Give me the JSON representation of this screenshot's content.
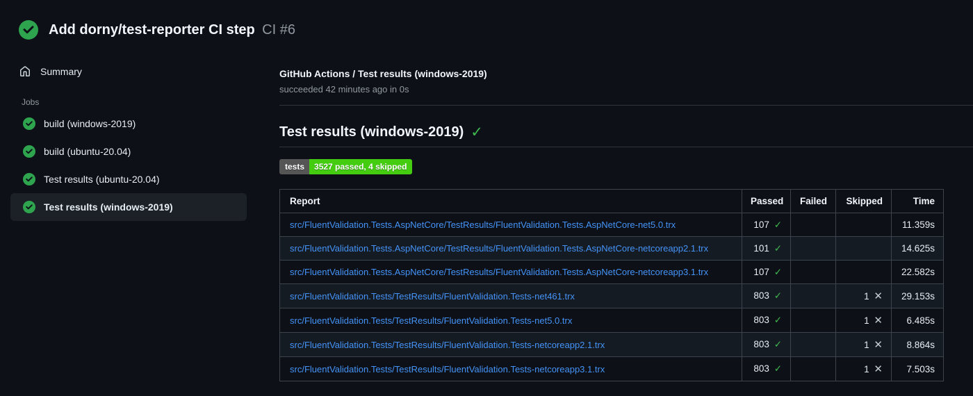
{
  "colors": {
    "background": "#0d1117",
    "success_green": "#2ea44f",
    "check_green": "#3fb950",
    "link_blue": "#4493f8",
    "badge_label_bg": "#555555",
    "badge_value_bg": "#44cc11",
    "selected_item_bg": "#1c2128"
  },
  "run_header": {
    "title": "Add dorny/test-reporter CI step",
    "run_number": "CI #6",
    "status": "success"
  },
  "sidebar": {
    "summary_label": "Summary",
    "jobs_label": "Jobs",
    "jobs": [
      {
        "label": "build (windows-2019)",
        "status": "success",
        "selected": false
      },
      {
        "label": "build (ubuntu-20.04)",
        "status": "success",
        "selected": false
      },
      {
        "label": "Test results (ubuntu-20.04)",
        "status": "success",
        "selected": false
      },
      {
        "label": "Test results (windows-2019)",
        "status": "success",
        "selected": true
      }
    ]
  },
  "main": {
    "job_title": "GitHub Actions / Test results (windows-2019)",
    "job_status_line": "succeeded 42 minutes ago in 0s",
    "section_title": "Test results (windows-2019)",
    "section_check": "✓",
    "badge": {
      "label": "tests",
      "value": "3527 passed, 4 skipped"
    },
    "table": {
      "headers": [
        "Report",
        "Passed",
        "Failed",
        "Skipped",
        "Time"
      ],
      "rows": [
        {
          "report": "src/FluentValidation.Tests.AspNetCore/TestResults/FluentValidation.Tests.AspNetCore-net5.0.trx",
          "passed": "107",
          "failed": "",
          "skipped": "",
          "time": "11.359s"
        },
        {
          "report": "src/FluentValidation.Tests.AspNetCore/TestResults/FluentValidation.Tests.AspNetCore-netcoreapp2.1.trx",
          "passed": "101",
          "failed": "",
          "skipped": "",
          "time": "14.625s"
        },
        {
          "report": "src/FluentValidation.Tests.AspNetCore/TestResults/FluentValidation.Tests.AspNetCore-netcoreapp3.1.trx",
          "passed": "107",
          "failed": "",
          "skipped": "",
          "time": "22.582s"
        },
        {
          "report": "src/FluentValidation.Tests/TestResults/FluentValidation.Tests-net461.trx",
          "passed": "803",
          "failed": "",
          "skipped": "1",
          "time": "29.153s"
        },
        {
          "report": "src/FluentValidation.Tests/TestResults/FluentValidation.Tests-net5.0.trx",
          "passed": "803",
          "failed": "",
          "skipped": "1",
          "time": "6.485s"
        },
        {
          "report": "src/FluentValidation.Tests/TestResults/FluentValidation.Tests-netcoreapp2.1.trx",
          "passed": "803",
          "failed": "",
          "skipped": "1",
          "time": "8.864s"
        },
        {
          "report": "src/FluentValidation.Tests/TestResults/FluentValidation.Tests-netcoreapp3.1.trx",
          "passed": "803",
          "failed": "",
          "skipped": "1",
          "time": "7.503s"
        }
      ]
    }
  }
}
